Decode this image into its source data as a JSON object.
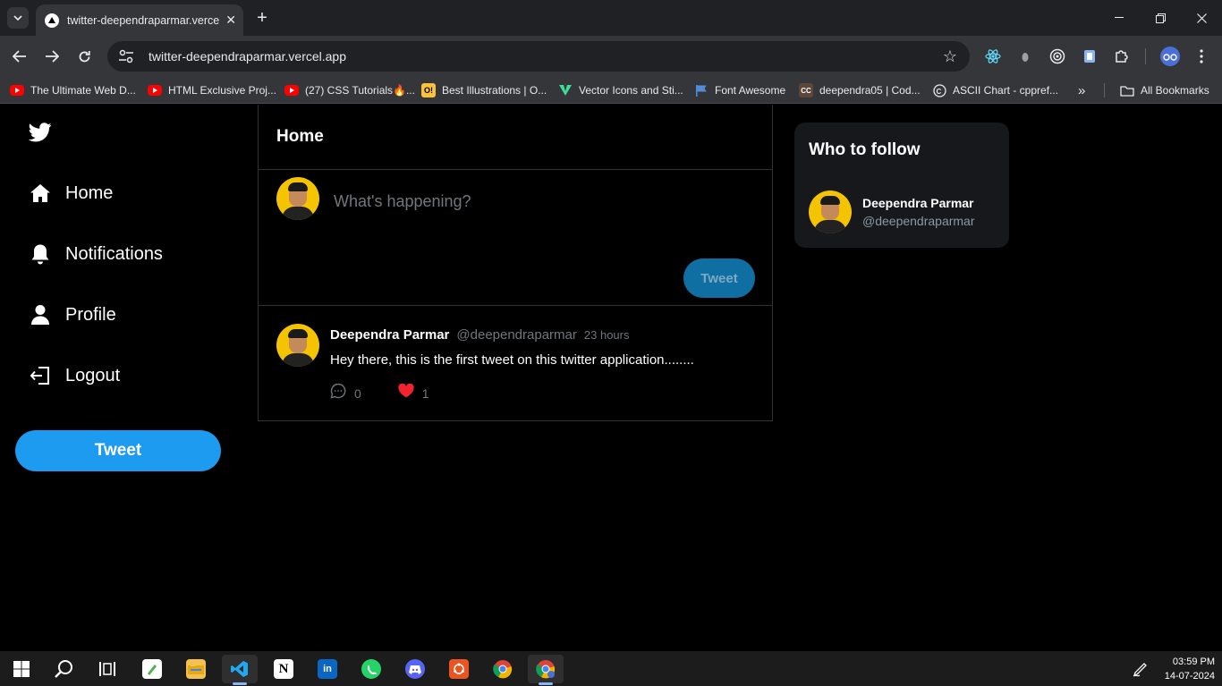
{
  "browser": {
    "tab_title": "twitter-deependraparmar.vercel.app",
    "url": "twitter-deependraparmar.vercel.app",
    "bookmarks": [
      {
        "label": "The Ultimate Web D...",
        "icon": "youtube-icon"
      },
      {
        "label": "HTML Exclusive Proj...",
        "icon": "youtube-icon"
      },
      {
        "label": "(27) CSS Tutorials🔥...",
        "icon": "youtube-icon"
      },
      {
        "label": "Best Illustrations | O...",
        "icon": "ouch-icon"
      },
      {
        "label": "Vector Icons and Sti...",
        "icon": "vector-icon"
      },
      {
        "label": "Font Awesome",
        "icon": "flag-icon"
      },
      {
        "label": "deependra05 | Cod...",
        "icon": "codechef-icon"
      },
      {
        "label": "ASCII Chart - cppref...",
        "icon": "cppref-icon"
      }
    ],
    "all_bookmarks": "All Bookmarks"
  },
  "sidebar": {
    "items": [
      {
        "label": "Home",
        "icon": "home-icon"
      },
      {
        "label": "Notifications",
        "icon": "bell-icon"
      },
      {
        "label": "Profile",
        "icon": "user-icon"
      },
      {
        "label": "Logout",
        "icon": "logout-icon"
      }
    ],
    "tweet_button": "Tweet"
  },
  "feed": {
    "title": "Home",
    "composer": {
      "placeholder": "What's happening?",
      "button": "Tweet"
    },
    "tweets": [
      {
        "name": "Deependra Parmar",
        "handle": "@deependraparmar",
        "time": "23 hours",
        "text": "Hey there, this is the first tweet on this twitter application........",
        "comments": "0",
        "likes": "1"
      }
    ]
  },
  "who_to_follow": {
    "title": "Who to follow",
    "users": [
      {
        "name": "Deependra Parmar",
        "handle": "@deependraparmar"
      }
    ]
  },
  "taskbar": {
    "time": "03:59 PM",
    "date": "14-07-2024"
  },
  "colors": {
    "accent": "#1d9bf0",
    "like": "#f91880",
    "muted": "#71767b"
  }
}
